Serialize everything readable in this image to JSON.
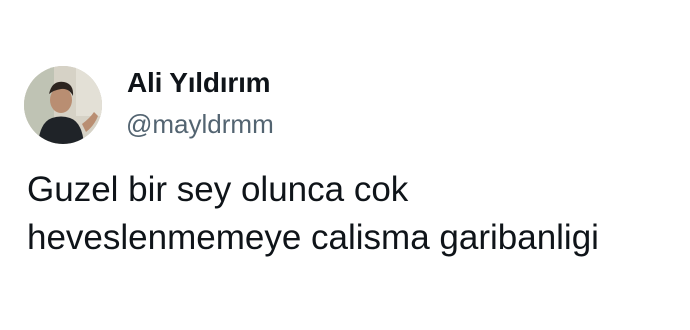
{
  "author": {
    "name": "Ali Yıldırım",
    "handle": "@mayldrmm",
    "avatar_icon": "profile-photo"
  },
  "tweet": {
    "lines": [
      "Guzel bir sey olunca cok",
      "heveslenmemeye calisma garibanligi"
    ]
  },
  "colors": {
    "text_primary": "#0f1419",
    "text_secondary": "#536471",
    "background": "#ffffff"
  }
}
